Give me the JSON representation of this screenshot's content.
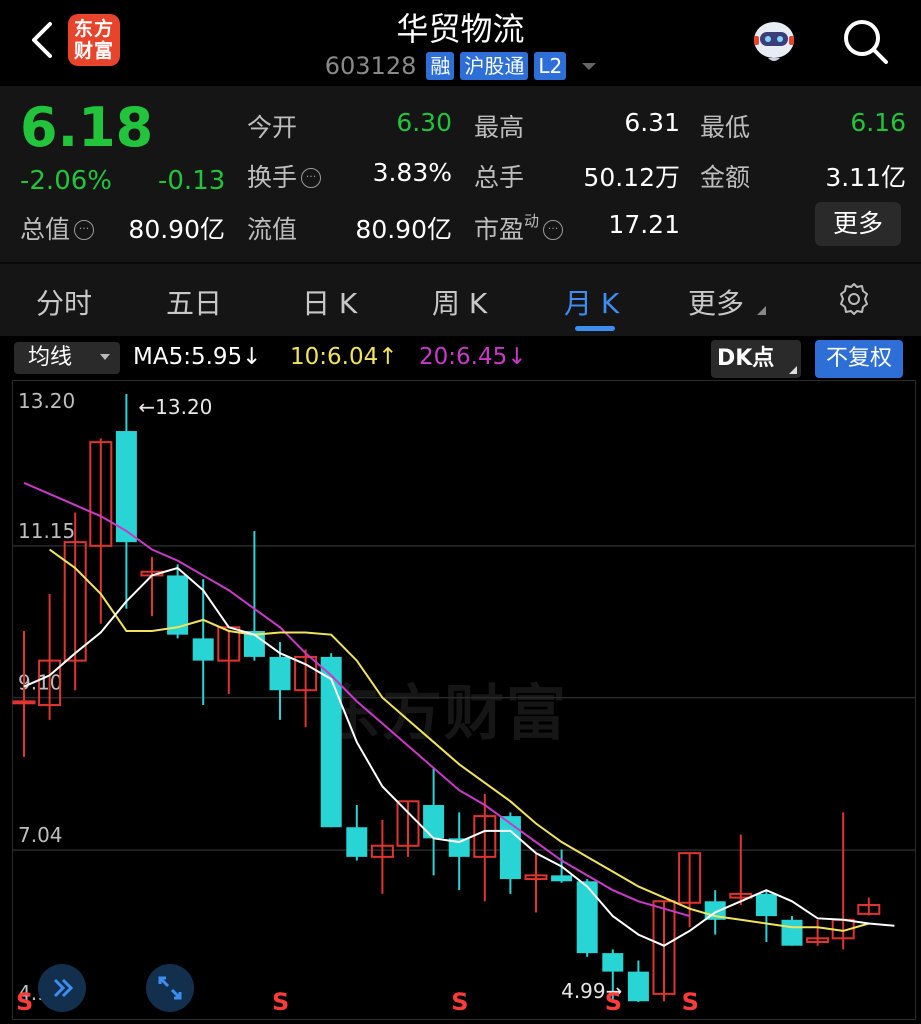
{
  "header": {
    "title": "华贸物流",
    "logo_line1": "东方",
    "logo_line2": "财富",
    "code": "603128",
    "tags": [
      "融",
      "沪股通",
      "L2"
    ]
  },
  "quote": {
    "price": "6.18",
    "change_pct": "-2.06%",
    "change_abs": "-0.13",
    "open_label": "今开",
    "open": "6.30",
    "high_label": "最高",
    "high": "6.31",
    "low_label": "最低",
    "low": "6.16",
    "turnover_label": "换手",
    "turnover": "3.83%",
    "volume_label": "总手",
    "volume": "50.12万",
    "amount_label": "金额",
    "amount": "3.11亿",
    "mktcap_label": "总值",
    "mktcap": "80.90亿",
    "float_label": "流值",
    "float": "80.90亿",
    "pe_label": "市盈",
    "pe_sup": "动",
    "pe": "17.21",
    "more_button": "更多"
  },
  "tabs": {
    "items": [
      "分时",
      "五日",
      "日 K",
      "周 K",
      "月 K",
      "更多"
    ],
    "active": "月 K"
  },
  "indicators": {
    "selector": "均线",
    "ma5": "MA5:5.95↓",
    "ma10": "10:6.04↑",
    "ma20": "20:6.45↓",
    "dk_button": "DK点",
    "fq_button": "不复权"
  },
  "colors": {
    "up": "#e0342f",
    "down": "#29d4d4",
    "ma5": "#ffffff",
    "ma10": "#f2e45a",
    "ma20": "#c93ac9",
    "accent": "#3d8ef0",
    "price_down": "#22c43c"
  },
  "chart_data": {
    "type": "candlestick",
    "y_tick_labels": [
      "13.20",
      "11.15",
      "9.10",
      "7.04",
      "4.99"
    ],
    "ylim": [
      4.99,
      13.2
    ],
    "max_label": "←13.20",
    "min_label": "4.99→",
    "watermark": "东方财富",
    "signal_markers": [
      "S",
      "S",
      "S",
      "S",
      "S"
    ],
    "candles": [
      {
        "o": 9.05,
        "h": 10.0,
        "l": 8.3,
        "c": 9.05
      },
      {
        "o": 9.0,
        "h": 10.5,
        "l": 8.8,
        "c": 9.6
      },
      {
        "o": 9.6,
        "h": 11.6,
        "l": 9.2,
        "c": 11.2
      },
      {
        "o": 11.15,
        "h": 12.6,
        "l": 10.1,
        "c": 12.55
      },
      {
        "o": 12.7,
        "h": 13.2,
        "l": 10.3,
        "c": 11.2
      },
      {
        "o": 10.75,
        "h": 11.0,
        "l": 10.2,
        "c": 10.8
      },
      {
        "o": 10.75,
        "h": 10.9,
        "l": 9.9,
        "c": 9.95
      },
      {
        "o": 9.9,
        "h": 10.7,
        "l": 9.0,
        "c": 9.6
      },
      {
        "o": 9.6,
        "h": 10.0,
        "l": 9.15,
        "c": 10.05
      },
      {
        "o": 10.0,
        "h": 11.35,
        "l": 9.6,
        "c": 9.65
      },
      {
        "o": 9.65,
        "h": 9.85,
        "l": 8.8,
        "c": 9.2
      },
      {
        "o": 9.2,
        "h": 9.75,
        "l": 8.7,
        "c": 9.65
      },
      {
        "o": 9.65,
        "h": 9.7,
        "l": 7.35,
        "c": 7.35
      },
      {
        "o": 7.35,
        "h": 7.65,
        "l": 6.9,
        "c": 6.95
      },
      {
        "o": 6.95,
        "h": 7.45,
        "l": 6.45,
        "c": 7.1
      },
      {
        "o": 7.1,
        "h": 7.7,
        "l": 6.95,
        "c": 7.7
      },
      {
        "o": 7.65,
        "h": 8.15,
        "l": 6.7,
        "c": 7.2
      },
      {
        "o": 7.2,
        "h": 7.55,
        "l": 6.5,
        "c": 6.95
      },
      {
        "o": 6.95,
        "h": 7.8,
        "l": 6.35,
        "c": 7.5
      },
      {
        "o": 7.5,
        "h": 7.55,
        "l": 6.45,
        "c": 6.65
      },
      {
        "o": 6.65,
        "h": 7.0,
        "l": 6.2,
        "c": 6.7
      },
      {
        "o": 6.7,
        "h": 7.05,
        "l": 6.6,
        "c": 6.62
      },
      {
        "o": 6.62,
        "h": 6.65,
        "l": 5.6,
        "c": 5.65
      },
      {
        "o": 5.65,
        "h": 5.7,
        "l": 5.0,
        "c": 5.4
      },
      {
        "o": 5.4,
        "h": 5.55,
        "l": 4.99,
        "c": 5.0
      },
      {
        "o": 5.1,
        "h": 6.35,
        "l": 5.0,
        "c": 6.35
      },
      {
        "o": 6.33,
        "h": 7.0,
        "l": 6.0,
        "c": 7.0
      },
      {
        "o": 6.35,
        "h": 6.5,
        "l": 5.9,
        "c": 6.1
      },
      {
        "o": 6.4,
        "h": 7.25,
        "l": 6.3,
        "c": 6.45
      },
      {
        "o": 6.45,
        "h": 6.5,
        "l": 5.8,
        "c": 6.15
      },
      {
        "o": 6.1,
        "h": 6.15,
        "l": 5.75,
        "c": 5.75
      },
      {
        "o": 5.8,
        "h": 6.1,
        "l": 5.75,
        "c": 5.85
      },
      {
        "o": 5.85,
        "h": 7.55,
        "l": 5.7,
        "c": 6.1
      },
      {
        "o": 6.18,
        "h": 6.4,
        "l": 6.16,
        "c": 6.3
      }
    ],
    "ma5": [
      9.25,
      9.4,
      9.7,
      9.98,
      10.4,
      10.75,
      10.85,
      10.55,
      10.05,
      9.95,
      9.7,
      9.55,
      9.35,
      8.5,
      7.9,
      7.55,
      7.2,
      7.15,
      7.3,
      7.3,
      7.0,
      6.82,
      6.55,
      6.15,
      5.9,
      5.75,
      5.95,
      6.2,
      6.35,
      6.5,
      6.35,
      6.12,
      6.1,
      6.05,
      6.02
    ],
    "ma10": [
      11.1,
      10.85,
      10.5,
      10.0,
      10.0,
      10.05,
      10.15,
      10.0,
      9.95,
      9.98,
      9.98,
      9.95,
      9.6,
      9.1,
      8.8,
      8.5,
      8.2,
      7.95,
      7.7,
      7.4,
      7.15,
      6.95,
      6.75,
      6.55,
      6.4,
      6.25,
      6.15,
      6.1,
      6.05,
      6.0,
      6.0,
      5.95,
      6.05
    ],
    "ma20": [
      12.0,
      11.85,
      11.7,
      11.55,
      11.35,
      11.1,
      10.95,
      10.75,
      10.55,
      10.3,
      10.05,
      9.7,
      9.4,
      9.05,
      8.75,
      8.45,
      8.15,
      7.85,
      7.65,
      7.4,
      7.15,
      6.9,
      6.7,
      6.5,
      6.35,
      6.25,
      6.15
    ],
    "ma10_start": 1,
    "ma20_start": 0
  }
}
